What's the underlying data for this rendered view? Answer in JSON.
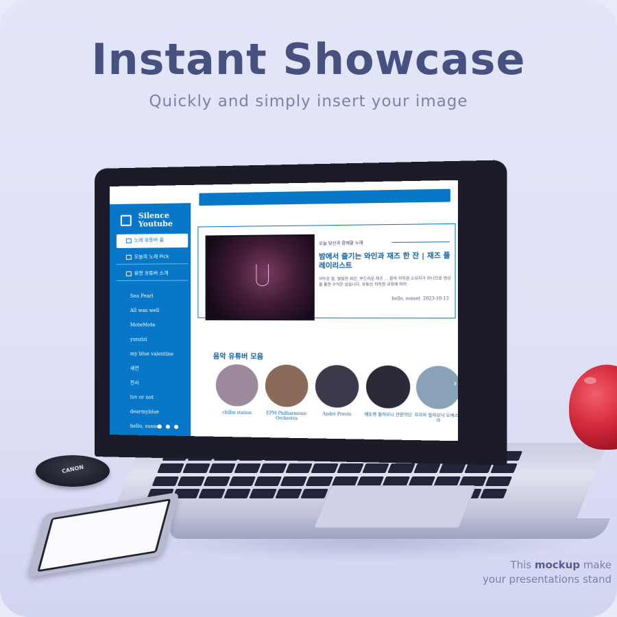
{
  "hero": {
    "title": "Instant Showcase",
    "subtitle": "Quickly and simply insert your image"
  },
  "tagline": {
    "line1_pre": "This ",
    "line1_bold": "mockup",
    "line1_post": " make",
    "line2": "your presentations  stand"
  },
  "site": {
    "brand": {
      "line1": "Silence",
      "line2": "Youtube"
    },
    "menu": [
      {
        "label": "노래 유튜버 홈",
        "icon": "headphones-icon",
        "active": true
      },
      {
        "label": "오늘의 노래 Pick",
        "icon": "calendar-icon",
        "active": false
      },
      {
        "label": "유명 유튜버 소개",
        "icon": "video-icon",
        "active": false
      }
    ],
    "channels": [
      "Sea Pearl",
      "All was well",
      "MoteMote",
      "yunzizi",
      "my blue valentine",
      "새연",
      "천사",
      "luv or not",
      "dearmyblue",
      "hello, sunset"
    ],
    "footer_icons": [
      "github-icon",
      "chat-icon",
      "mail-icon"
    ],
    "feature": {
      "kicker": "오늘 당신과 함께할 노래",
      "title": "밤에서 즐기는 와인과 재즈 한 잔 | 재즈 플레이리스트",
      "description": "어두운 밤, 달달한 와인, 부드러운 재즈 ... 음악 저작권 소유자가 아니므로 영상을 통한 수익은 없습니다. 유튜브 저작권 규정에 따라",
      "author": "hello, sunset",
      "date": "2023-10-13"
    },
    "section_title": "음악 유튜버 모음",
    "channels_row": [
      {
        "label": "chillin station",
        "color": "#9c8a9c"
      },
      {
        "label": "EPM Philharmonic Orchestra",
        "color": "#8a6a58"
      },
      {
        "label": "André Previn",
        "color": "#3a3a4a"
      },
      {
        "label": "베토벤 월하모니 관현악단",
        "color": "#2a2a38"
      },
      {
        "label": "프라하 필하모닉 오케스트라",
        "color": "#8aa2b8"
      }
    ],
    "lens_cap_text": "CANON"
  },
  "colors": {
    "accent": "#0877c7",
    "title": "#47517f"
  }
}
